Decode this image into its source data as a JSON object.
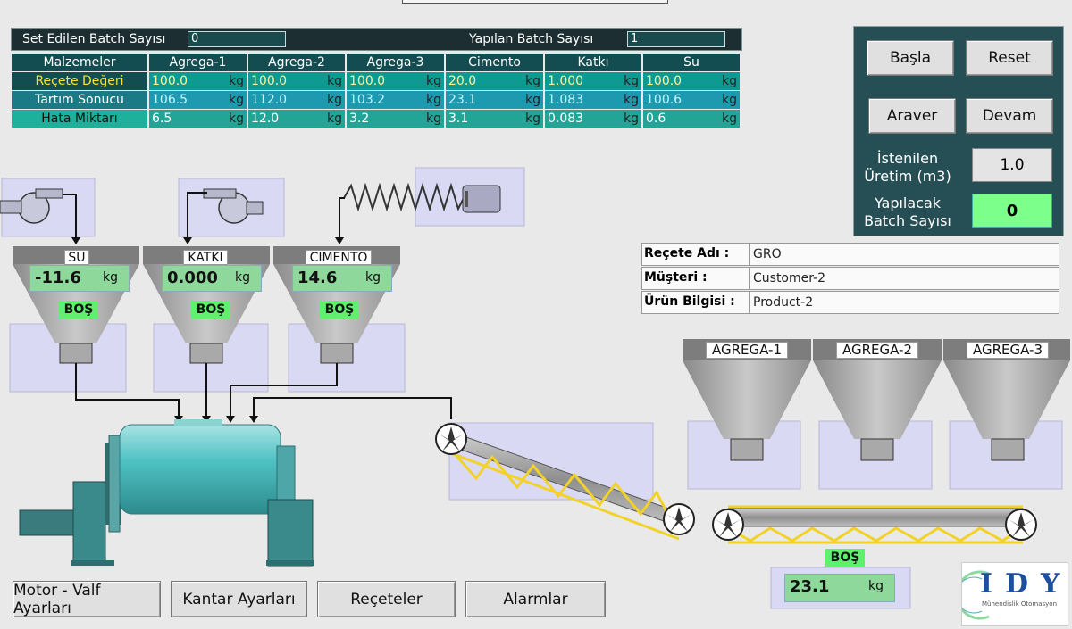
{
  "batch": {
    "set_label": "Set Edilen Batch Sayısı",
    "set_value": "0",
    "done_label": "Yapılan Batch Sayısı",
    "done_value": "1"
  },
  "table": {
    "headers": [
      "Malzemeler",
      "Agrega-1",
      "Agrega-2",
      "Agrega-3",
      "Cimento",
      "Katkı",
      "Su"
    ],
    "unit": "kg",
    "rows": [
      {
        "label": "Reçete Değeri",
        "values": [
          "100.0",
          "100.0",
          "100.0",
          "20.0",
          "1.000",
          "100.0"
        ]
      },
      {
        "label": "Tartım Sonucu",
        "values": [
          "106.5",
          "112.0",
          "103.2",
          "23.1",
          "1.083",
          "100.6"
        ]
      },
      {
        "label": "Hata Miktarı",
        "values": [
          "6.5",
          "12.0",
          "3.2",
          "3.1",
          "0.083",
          "0.6"
        ]
      }
    ]
  },
  "control": {
    "start": "Başla",
    "reset": "Reset",
    "pause": "Araver",
    "resume": "Devam",
    "production_label_1": "İstenilen",
    "production_label_2": "Üretim (m3)",
    "production_value": "1.0",
    "batch_label_1": "Yapılacak",
    "batch_label_2": "Batch Sayısı",
    "batch_value": "0"
  },
  "recipe": {
    "name_label": "Reçete Adı  :",
    "name_value": "GRO",
    "customer_label": "Müşteri       :",
    "customer_value": "Customer-2",
    "product_label": "Ürün Bilgisi  :",
    "product_value": "Product-2"
  },
  "hoppers": {
    "su": {
      "label": "SU",
      "value": "-11.6",
      "unit": "kg",
      "status": "BOŞ"
    },
    "katki": {
      "label": "KATKI",
      "value": "0.000",
      "unit": "kg",
      "status": "BOŞ"
    },
    "cimento": {
      "label": "CIMENTO",
      "value": "14.6",
      "unit": "kg",
      "status": "BOŞ"
    },
    "agrega1": {
      "label": "AGREGA-1"
    },
    "agrega2": {
      "label": "AGREGA-2"
    },
    "agrega3": {
      "label": "AGREGA-3"
    },
    "agrega_scale": {
      "value": "23.1",
      "unit": "kg",
      "status": "BOŞ"
    }
  },
  "nav": {
    "motor": "Motor - Valf Ayarları",
    "kantar": "Kantar Ayarları",
    "receteler": "Reçeteler",
    "alarmlar": "Alarmlar"
  },
  "logo": {
    "letters": "IDY",
    "tagline": "Mühendislik Otomasyon"
  },
  "colors": {
    "panel": "#264e55",
    "table_header": "#134d51",
    "scale_green": "#8dd89a",
    "status_green": "#60ef6e",
    "conveyor": "#f2d229",
    "mixer": "#4fc2c4"
  }
}
